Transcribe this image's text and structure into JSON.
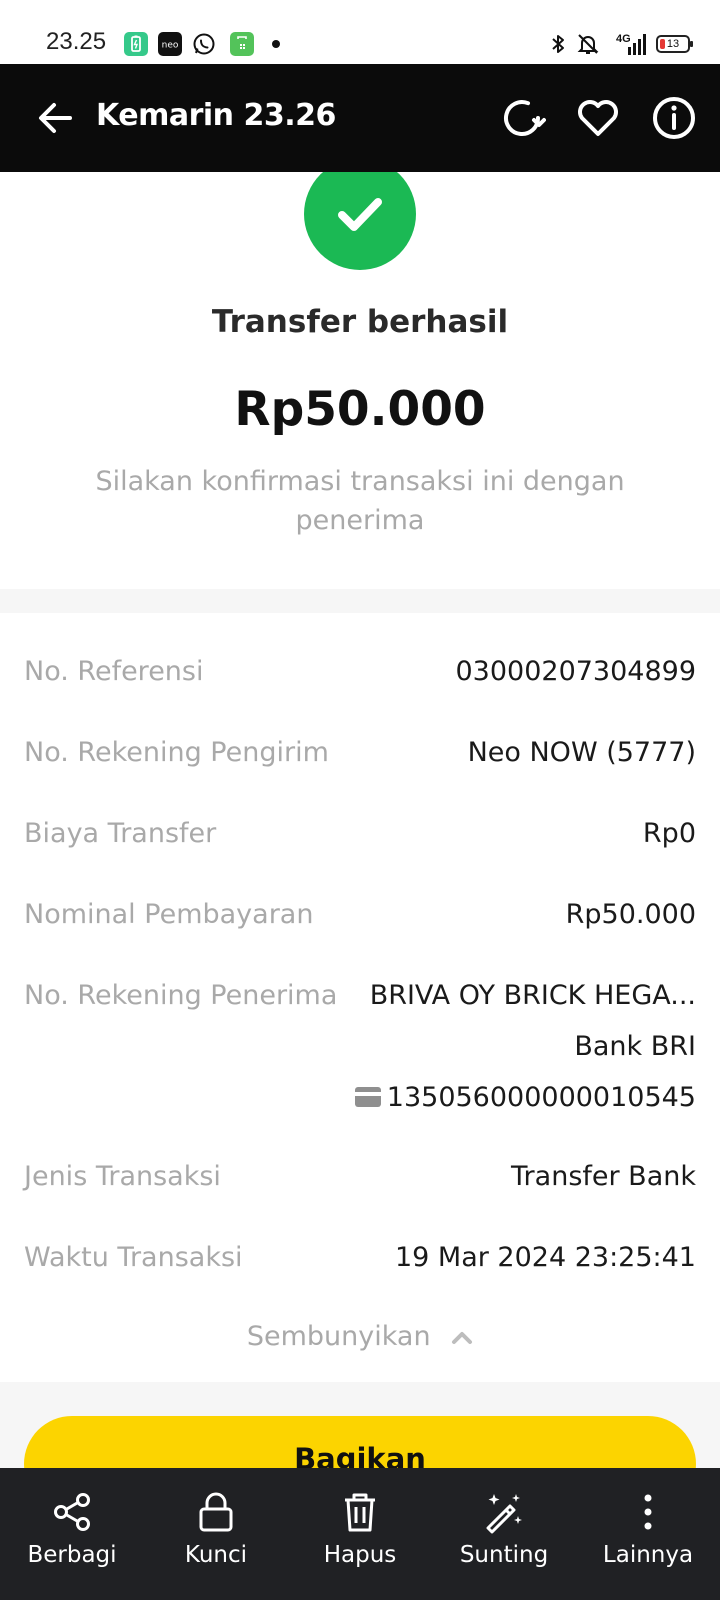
{
  "status_bar": {
    "time": "23.25",
    "network": "4G",
    "battery": "13",
    "app_icons": [
      "battery-saver-icon",
      "neo-app-icon",
      "whatsapp-icon",
      "shop-app-icon"
    ]
  },
  "header": {
    "title": "Kemarin 23.26",
    "icons": [
      "back-arrow-icon",
      "rotate-icon",
      "heart-icon",
      "info-icon"
    ]
  },
  "result": {
    "title": "Transfer berhasil",
    "amount": "Rp50.000",
    "subtitle": "Silakan konfirmasi transaksi ini dengan penerima",
    "status_color": "#1bb954"
  },
  "details": {
    "reference": {
      "label": "No. Referensi",
      "value": "03000207304899"
    },
    "sender": {
      "label": "No. Rekening Pengirim",
      "value": "Neo NOW (5777)"
    },
    "fee": {
      "label": "Biaya Transfer",
      "value": "Rp0"
    },
    "nominal": {
      "label": "Nominal Pembayaran",
      "value": "Rp50.000"
    },
    "recipient": {
      "label": "No. Rekening Penerima",
      "name": "BRIVA OY BRICK HEGA...",
      "bank": "Bank BRI",
      "account": "135056000000010545"
    },
    "type": {
      "label": "Jenis Transaksi",
      "value": "Transfer Bank"
    },
    "time": {
      "label": "Waktu Transaksi",
      "value": "19 Mar 2024 23:25:41"
    }
  },
  "hide_toggle": "Sembunyikan",
  "share_button": "Bagikan",
  "accent_color": "#fcd400",
  "toolbar": {
    "items": [
      {
        "label": "Berbagi",
        "icon": "share-icon"
      },
      {
        "label": "Kunci",
        "icon": "lock-icon"
      },
      {
        "label": "Hapus",
        "icon": "trash-icon"
      },
      {
        "label": "Sunting",
        "icon": "magic-wand-icon"
      },
      {
        "label": "Lainnya",
        "icon": "more-vertical-icon"
      }
    ]
  }
}
